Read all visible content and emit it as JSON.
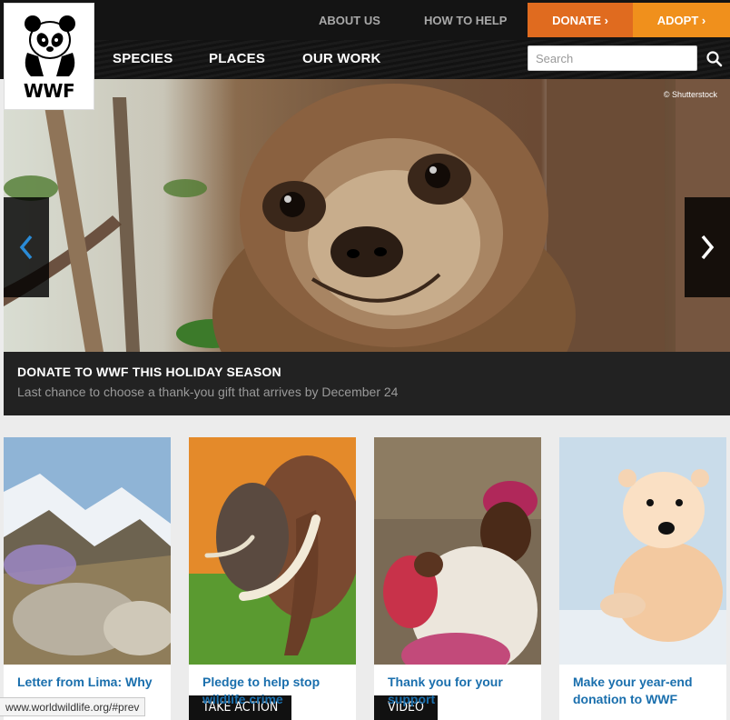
{
  "brand": {
    "name": "WWF"
  },
  "top_nav": {
    "about": "ABOUT US",
    "help": "HOW TO HELP",
    "donate": "DONATE ›",
    "adopt": "ADOPT ›"
  },
  "main_nav": {
    "species": "SPECIES",
    "places": "PLACES",
    "work": "OUR WORK"
  },
  "search": {
    "placeholder": "Search"
  },
  "hero": {
    "credit": "© Shutterstock",
    "title": "DONATE TO WWF THIS HOLIDAY SEASON",
    "subtitle": "Last chance to choose a thank-you gift that arrives by December 24"
  },
  "cards": [
    {
      "title": "Letter from Lima: Why"
    },
    {
      "tag": "TAKE ACTION",
      "title": "Pledge to help stop wildlife crime"
    },
    {
      "tag": "VIDEO",
      "title": "Thank you for your support"
    },
    {
      "title": "Make your year-end donation to WWF"
    }
  ],
  "status_url": "www.worldwildlife.org/#prev",
  "colors": {
    "donate": "#e06b1f",
    "adopt": "#f0901c",
    "link": "#1a6fad",
    "header": "#141414"
  },
  "icons": [
    "panda-logo",
    "search-icon",
    "chevron-left-icon",
    "chevron-right-icon"
  ]
}
